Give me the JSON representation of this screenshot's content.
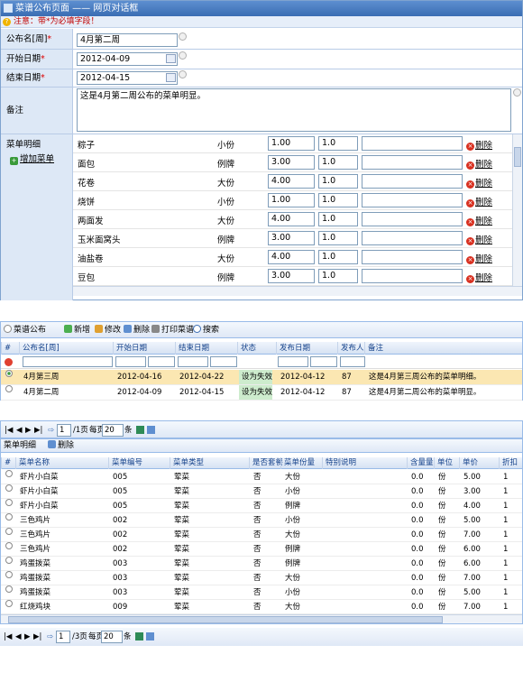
{
  "dialog": {
    "title": "菜谱公布页面 —— 网页对话框",
    "notice": "注意：带*为必填字段！",
    "fields": {
      "name_label": "公布名[周]",
      "name_value": "4月第二周",
      "start_label": "开始日期",
      "start_value": "2012-04-09",
      "end_label": "结束日期",
      "end_value": "2012-04-15",
      "remark_label": "备注",
      "remark_value": "这是4月第二周公布的菜单明显。"
    },
    "detail_label": "菜单明细",
    "add_label": "增加菜单",
    "delete_label": "删除",
    "items": [
      {
        "name": "粽子",
        "portion": "小份",
        "price": "1.00",
        "qty": "1.0"
      },
      {
        "name": "面包",
        "portion": "例牌",
        "price": "3.00",
        "qty": "1.0"
      },
      {
        "name": "花卷",
        "portion": "大份",
        "price": "4.00",
        "qty": "1.0"
      },
      {
        "name": "烧饼",
        "portion": "小份",
        "price": "1.00",
        "qty": "1.0"
      },
      {
        "name": "两面发",
        "portion": "大份",
        "price": "4.00",
        "qty": "1.0"
      },
      {
        "name": "玉米面窝头",
        "portion": "例牌",
        "price": "3.00",
        "qty": "1.0"
      },
      {
        "name": "油盐卷",
        "portion": "大份",
        "price": "4.00",
        "qty": "1.0"
      },
      {
        "name": "豆包",
        "portion": "例牌",
        "price": "3.00",
        "qty": "1.0"
      }
    ]
  },
  "publish": {
    "title": "菜谱公布",
    "toolbar": {
      "add": "新增",
      "edit": "修改",
      "delete": "删除",
      "print": "打印菜谱",
      "search": "搜索"
    },
    "columns": [
      "#",
      "公布名[周]",
      "开始日期",
      "结束日期",
      "状态",
      "发布日期",
      "发布人",
      "备注"
    ],
    "rows": [
      {
        "name": "4月第三周",
        "start": "2012-04-16",
        "end": "2012-04-22",
        "status": "设为失效",
        "pub": "2012-04-12",
        "user": "87",
        "remark": "这是4月第三周公布的菜单明细。"
      },
      {
        "name": "4月第二周",
        "start": "2012-04-09",
        "end": "2012-04-15",
        "status": "设为失效",
        "pub": "2012-04-12",
        "user": "87",
        "remark": "这是4月第二周公布的菜单明显。"
      }
    ]
  },
  "pager1": {
    "page": "1",
    "total": "/1页",
    "per_label": "每页",
    "per_value": "20",
    "unit": "条"
  },
  "menu": {
    "title": "菜单明细",
    "delete": "删除",
    "columns": [
      "#",
      "菜单名称",
      "菜单编号",
      "菜单类型",
      "是否套餐",
      "菜单份量",
      "特别说明",
      "含量量",
      "单位",
      "单价",
      "折扣"
    ],
    "rows": [
      {
        "name": "虾片小白菜",
        "code": "005",
        "type": "荤菜",
        "set": "否",
        "portion": "大份",
        "amount": "0.0",
        "unit": "份",
        "price": "5.00",
        "disc": "1"
      },
      {
        "name": "虾片小白菜",
        "code": "005",
        "type": "荤菜",
        "set": "否",
        "portion": "小份",
        "amount": "0.0",
        "unit": "份",
        "price": "3.00",
        "disc": "1"
      },
      {
        "name": "虾片小白菜",
        "code": "005",
        "type": "荤菜",
        "set": "否",
        "portion": "例牌",
        "amount": "0.0",
        "unit": "份",
        "price": "4.00",
        "disc": "1"
      },
      {
        "name": "三色鸡片",
        "code": "002",
        "type": "荤菜",
        "set": "否",
        "portion": "小份",
        "amount": "0.0",
        "unit": "份",
        "price": "5.00",
        "disc": "1"
      },
      {
        "name": "三色鸡片",
        "code": "002",
        "type": "荤菜",
        "set": "否",
        "portion": "大份",
        "amount": "0.0",
        "unit": "份",
        "price": "7.00",
        "disc": "1"
      },
      {
        "name": "三色鸡片",
        "code": "002",
        "type": "荤菜",
        "set": "否",
        "portion": "例牌",
        "amount": "0.0",
        "unit": "份",
        "price": "6.00",
        "disc": "1"
      },
      {
        "name": "鸡蛋拨菜",
        "code": "003",
        "type": "荤菜",
        "set": "否",
        "portion": "例牌",
        "amount": "0.0",
        "unit": "份",
        "price": "6.00",
        "disc": "1"
      },
      {
        "name": "鸡蛋拨菜",
        "code": "003",
        "type": "荤菜",
        "set": "否",
        "portion": "大份",
        "amount": "0.0",
        "unit": "份",
        "price": "7.00",
        "disc": "1"
      },
      {
        "name": "鸡蛋拨菜",
        "code": "003",
        "type": "荤菜",
        "set": "否",
        "portion": "小份",
        "amount": "0.0",
        "unit": "份",
        "price": "5.00",
        "disc": "1"
      },
      {
        "name": "红烧鸡块",
        "code": "009",
        "type": "荤菜",
        "set": "否",
        "portion": "大份",
        "amount": "0.0",
        "unit": "份",
        "price": "7.00",
        "disc": "1"
      }
    ]
  },
  "pager2": {
    "page": "1",
    "total": "/3页",
    "per_label": "每页",
    "per_value": "20",
    "unit": "条"
  }
}
